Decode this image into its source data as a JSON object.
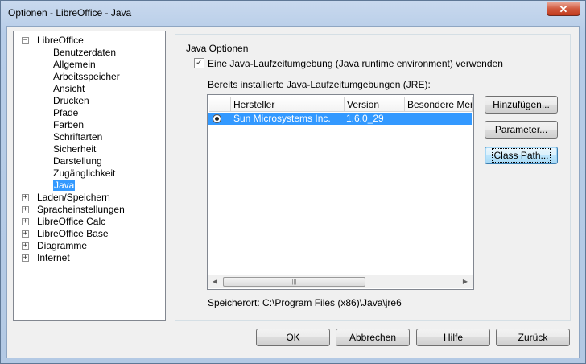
{
  "window": {
    "title": "Optionen - LibreOffice - Java",
    "close_glyph": "✕"
  },
  "tree": [
    {
      "label": "LibreOffice",
      "expander": "−",
      "level": 0
    },
    {
      "label": "Benutzerdaten",
      "level": 1
    },
    {
      "label": "Allgemein",
      "level": 1
    },
    {
      "label": "Arbeitsspeicher",
      "level": 1
    },
    {
      "label": "Ansicht",
      "level": 1
    },
    {
      "label": "Drucken",
      "level": 1
    },
    {
      "label": "Pfade",
      "level": 1
    },
    {
      "label": "Farben",
      "level": 1
    },
    {
      "label": "Schriftarten",
      "level": 1
    },
    {
      "label": "Sicherheit",
      "level": 1
    },
    {
      "label": "Darstellung",
      "level": 1
    },
    {
      "label": "Zugänglichkeit",
      "level": 1
    },
    {
      "label": "Java",
      "level": 1,
      "selected": true
    },
    {
      "label": "Laden/Speichern",
      "expander": "+",
      "level": 0
    },
    {
      "label": "Spracheinstellungen",
      "expander": "+",
      "level": 0
    },
    {
      "label": "LibreOffice Calc",
      "expander": "+",
      "level": 0
    },
    {
      "label": "LibreOffice Base",
      "expander": "+",
      "level": 0
    },
    {
      "label": "Diagramme",
      "expander": "+",
      "level": 0
    },
    {
      "label": "Internet",
      "expander": "+",
      "level": 0
    }
  ],
  "java": {
    "group_title": "Java Optionen",
    "use_jre_checkbox": {
      "checked": true,
      "label": "Eine Java-Laufzeitumgebung (Java runtime environment) verwenden"
    },
    "jre_list_label": "Bereits installierte Java-Laufzeitumgebungen (JRE):",
    "columns": [
      "Hersteller",
      "Version",
      "Besondere Merk"
    ],
    "rows": [
      {
        "vendor": "Sun Microsystems Inc.",
        "version": "1.6.0_29",
        "features": ""
      }
    ],
    "scroll": {
      "left": "◀",
      "right": "▶",
      "grip": "|||"
    },
    "location": "Speicherort: C:\\Program Files (x86)\\Java\\jre6"
  },
  "side_buttons": {
    "add": "Hinzufügen...",
    "parameter": "Parameter...",
    "class_path": "Class Path..."
  },
  "footer_buttons": {
    "ok": "OK",
    "cancel": "Abbrechen",
    "help": "Hilfe",
    "back": "Zurück"
  },
  "colors": {
    "selection": "#3399ff",
    "title_bar": "#b9cfe9",
    "close_button": "#c94a2d"
  }
}
